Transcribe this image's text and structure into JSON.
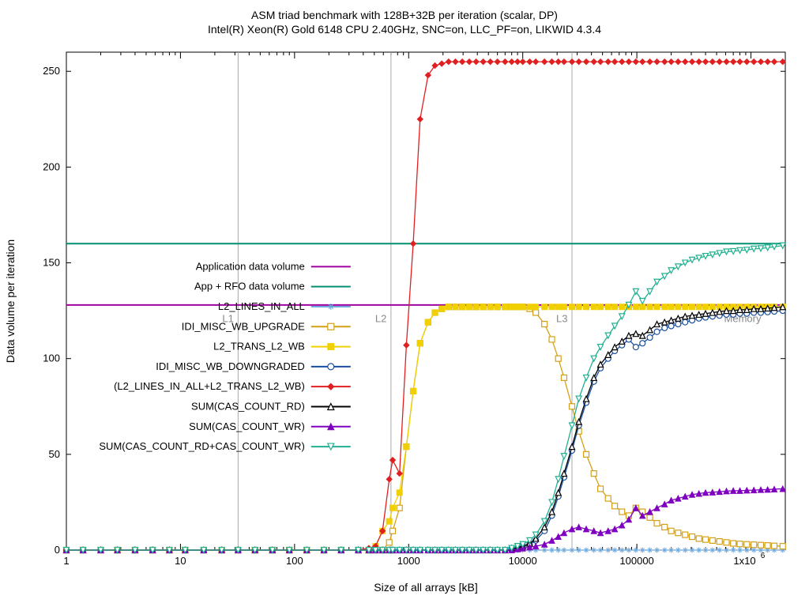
{
  "chart_data": {
    "type": "line",
    "title": "ASM triad benchmark with 128B+32B per iteration (scalar, DP)",
    "subtitle": "Intel(R) Xeon(R) Gold 6148 CPU 2.40GHz, SNC=on, LLC_PF=on, LIKWID 4.3.4",
    "xlabel": "Size of all arrays [kB]",
    "ylabel": "Data volume per iteration",
    "x_scale": "log10",
    "xlim": [
      1,
      2000000
    ],
    "ylim": [
      0,
      260
    ],
    "x_ticks": [
      1,
      10,
      100,
      1000,
      10000,
      100000,
      1000000
    ],
    "x_tick_labels": [
      "1",
      "10",
      "100",
      "1000",
      "10000",
      "100000",
      "1x10^6"
    ],
    "y_ticks": [
      0,
      50,
      100,
      150,
      200,
      250
    ],
    "cache_markers": [
      {
        "label": "L1",
        "x_kb": 32
      },
      {
        "label": "L2",
        "x_kb": 700
      },
      {
        "label": "L3",
        "x_kb": 27000
      },
      {
        "label": "Memory",
        "x_kb": 800000
      }
    ],
    "reference_lines": [
      {
        "name": "Application data volume",
        "y": 128,
        "color": "#a000a0"
      },
      {
        "name": "App + RFO data volume",
        "y": 160,
        "color": "#009070"
      }
    ],
    "x": [
      1,
      1.4,
      2,
      2.8,
      4,
      5.7,
      8,
      11,
      16,
      23,
      32,
      45,
      64,
      90,
      128,
      181,
      256,
      362,
      448,
      512,
      590,
      676,
      724,
      832,
      955,
      1096,
      1260,
      1480,
      1700,
      1950,
      2240,
      2570,
      2950,
      3400,
      3900,
      4500,
      5200,
      6000,
      7000,
      8000,
      9000,
      10000,
      11500,
      13000,
      15500,
      18000,
      20500,
      23000,
      27000,
      31000,
      36000,
      42000,
      48000,
      56000,
      64000,
      74000,
      85000,
      98000,
      112000,
      130000,
      150000,
      175000,
      200000,
      230000,
      265000,
      305000,
      350000,
      400000,
      460000,
      530000,
      610000,
      700000,
      800000,
      920000,
      1060000,
      1220000,
      1400000,
      1600000,
      1900000
    ],
    "series": [
      {
        "name": "L2_LINES_IN_ALL",
        "marker": "asterisk",
        "color": "#6fa8dc",
        "values": [
          0,
          0,
          0,
          0,
          0,
          0,
          0,
          0,
          0,
          0,
          0,
          0,
          0,
          0,
          0,
          0,
          0,
          0,
          0,
          0,
          0,
          0,
          0,
          0,
          0,
          0,
          0,
          0,
          0,
          0,
          0,
          0,
          0,
          0,
          0,
          0,
          0,
          0,
          0,
          0,
          0,
          0,
          0,
          0,
          0,
          0,
          0,
          0,
          0,
          0,
          0,
          0,
          0,
          0,
          0,
          0,
          0,
          0,
          0,
          0,
          0,
          0,
          0,
          0,
          0,
          0,
          0,
          0,
          0,
          0,
          0,
          0,
          0,
          0,
          0,
          0,
          0,
          0,
          0
        ]
      },
      {
        "name": "IDI_MISC_WB_UPGRADE",
        "marker": "open-square",
        "color": "#d4a017",
        "values": [
          0,
          0,
          0,
          0,
          0,
          0,
          0,
          0,
          0,
          0,
          0,
          0,
          0,
          0,
          0,
          0,
          0,
          0,
          0,
          0,
          0,
          4,
          10,
          22,
          54,
          83,
          108,
          119,
          124,
          126,
          127,
          127,
          127,
          127,
          127,
          127,
          127,
          127,
          127,
          127,
          127,
          127,
          126,
          124,
          118,
          110,
          100,
          90,
          75,
          62,
          50,
          40,
          32,
          27,
          23,
          20,
          18,
          22,
          20,
          17,
          14,
          12,
          10,
          9,
          8,
          7,
          6,
          5.5,
          5,
          4.5,
          4,
          3.5,
          3.2,
          3,
          2.8,
          2.6,
          2.4,
          2.2,
          2
        ]
      },
      {
        "name": "L2_TRANS_L2_WB",
        "marker": "filled-square",
        "color": "#f0d000",
        "values": [
          0,
          0,
          0,
          0,
          0,
          0,
          0,
          0,
          0,
          0,
          0,
          0,
          0,
          0,
          0,
          0,
          0,
          0,
          0,
          2,
          10,
          15,
          22,
          30,
          54,
          83,
          108,
          119,
          124,
          126,
          127,
          127,
          127,
          127,
          127,
          127,
          127,
          127,
          127,
          127,
          127,
          127,
          127,
          127,
          127,
          127,
          127,
          127,
          127,
          127,
          127,
          127,
          127,
          127,
          127,
          127,
          127,
          127,
          127,
          127,
          127,
          127,
          127,
          127,
          127,
          127,
          127,
          127,
          127,
          127,
          127,
          127,
          127,
          127,
          127,
          127,
          127,
          127,
          127
        ]
      },
      {
        "name": "IDI_MISC_WB_DOWNGRADED",
        "marker": "open-circle",
        "color": "#1a4e9e",
        "values": [
          0,
          0,
          0,
          0,
          0,
          0,
          0,
          0,
          0,
          0,
          0,
          0,
          0,
          0,
          0,
          0,
          0,
          0,
          0,
          0,
          0,
          0,
          0,
          0,
          0,
          0,
          0,
          0,
          0,
          0,
          0,
          0,
          0,
          0,
          0,
          0,
          0,
          0,
          0,
          1,
          1,
          2,
          3,
          5,
          10,
          18,
          28,
          38,
          52,
          65,
          77,
          88,
          95,
          100,
          104,
          107,
          110,
          106,
          108,
          111,
          114,
          116,
          117,
          118,
          119,
          120,
          121,
          121.5,
          122,
          122.5,
          123,
          123,
          123.5,
          123.5,
          124,
          124,
          124.3,
          124.6,
          125
        ]
      },
      {
        "name": "(L2_LINES_IN_ALL+L2_TRANS_L2_WB)",
        "marker": "filled-diamond",
        "color": "#e02020",
        "values": [
          0,
          0,
          0,
          0,
          0,
          0,
          0,
          0,
          0,
          0,
          0,
          0,
          0,
          0,
          0,
          0,
          0,
          0,
          1,
          2,
          10,
          37,
          47,
          40,
          107,
          160,
          225,
          248,
          253,
          254,
          255,
          255,
          255,
          255,
          255,
          255,
          255,
          255,
          255,
          255,
          255,
          255,
          255,
          255,
          255,
          255,
          255,
          255,
          255,
          255,
          255,
          255,
          255,
          255,
          255,
          255,
          255,
          255,
          255,
          255,
          255,
          255,
          255,
          255,
          255,
          255,
          255,
          255,
          255,
          255,
          255,
          255,
          255,
          255,
          255,
          255,
          255,
          255,
          255
        ]
      },
      {
        "name": "SUM(CAS_COUNT_RD)",
        "marker": "open-tri-up",
        "color": "#000000",
        "values": [
          0,
          0,
          0,
          0,
          0,
          0,
          0,
          0,
          0,
          0,
          0,
          0,
          0,
          0,
          0,
          0,
          0,
          0,
          0,
          0,
          0,
          0,
          0,
          0,
          0,
          0,
          0,
          0,
          0,
          0,
          0,
          0,
          0,
          0,
          0,
          0,
          0,
          0,
          0,
          1,
          1.5,
          2,
          3.5,
          6,
          12,
          20,
          30,
          40,
          54,
          67,
          79,
          90,
          97,
          102,
          106,
          109,
          112,
          113,
          112,
          115,
          118,
          119,
          120,
          121,
          122,
          122.5,
          123,
          123.5,
          124,
          124.5,
          125,
          125,
          125.5,
          125.5,
          126,
          126,
          126.3,
          126.6,
          127
        ]
      },
      {
        "name": "SUM(CAS_COUNT_WR)",
        "marker": "filled-tri-up",
        "color": "#8000c0",
        "values": [
          0,
          0,
          0,
          0,
          0,
          0,
          0,
          0,
          0,
          0,
          0,
          0,
          0,
          0,
          0,
          0,
          0,
          0,
          0,
          0,
          0,
          0,
          0,
          0,
          0,
          0,
          0,
          0,
          0,
          0,
          0,
          0,
          0,
          0,
          0,
          0,
          0,
          0,
          0,
          0,
          0.5,
          1,
          1.5,
          2,
          3,
          5,
          7,
          9,
          11,
          12,
          11,
          10,
          9,
          10,
          11,
          13,
          16,
          22,
          18,
          20,
          22,
          24,
          26,
          27,
          28,
          29,
          29.5,
          30,
          30.2,
          30.5,
          30.8,
          31,
          31,
          31.2,
          31.3,
          31.5,
          31.6,
          31.8,
          32
        ]
      },
      {
        "name": "SUM(CAS_COUNT_RD+CAS_COUNT_WR)",
        "marker": "open-tri-down",
        "color": "#20b090",
        "values": [
          0,
          0,
          0,
          0,
          0,
          0,
          0,
          0,
          0,
          0,
          0,
          0,
          0,
          0,
          0,
          0,
          0,
          0,
          0,
          0,
          0,
          0,
          0,
          0,
          0,
          0,
          0,
          0,
          0,
          0,
          0,
          0,
          0,
          0,
          0,
          0,
          0,
          0,
          0,
          1,
          2,
          3,
          5,
          8,
          15,
          25,
          37,
          49,
          65,
          79,
          90,
          100,
          106,
          112,
          117,
          122,
          128,
          135,
          130,
          135,
          140,
          143,
          146,
          148,
          150,
          151.5,
          152.5,
          153.5,
          154.2,
          155,
          155.8,
          156,
          156.5,
          156.7,
          157.3,
          157.5,
          157.9,
          158.4,
          159
        ]
      }
    ],
    "legend_order": [
      "Application data volume",
      "App + RFO data volume",
      "L2_LINES_IN_ALL",
      "IDI_MISC_WB_UPGRADE",
      "L2_TRANS_L2_WB",
      "IDI_MISC_WB_DOWNGRADED",
      "(L2_LINES_IN_ALL+L2_TRANS_L2_WB)",
      "SUM(CAS_COUNT_RD)",
      "SUM(CAS_COUNT_WR)",
      "SUM(CAS_COUNT_RD+CAS_COUNT_WR)"
    ]
  }
}
